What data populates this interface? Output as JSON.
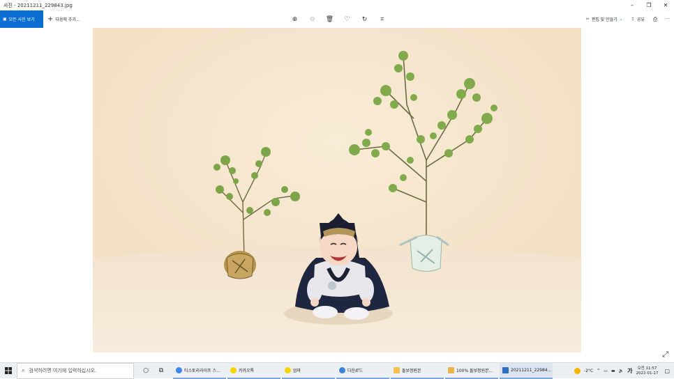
{
  "window": {
    "title": "사진 - 20211211_229843.jpg",
    "controls": {
      "minimize": "–",
      "maximize": "❐",
      "close": "✕"
    }
  },
  "toolbar": {
    "all_photos": "모든 사진 보기",
    "add_to": "다음에 추가...",
    "edit_create": "편집 및 만들기",
    "share": "공유",
    "more": "···"
  },
  "taskbar": {
    "search_placeholder": "검색하려면 여기에 입력하십시오.",
    "apps": [
      {
        "label": "티스토리라이프 스...",
        "color": "#4285f4"
      },
      {
        "label": "카카오톡",
        "color": "#f7d600"
      },
      {
        "label": "엄마",
        "color": "#f7d600"
      },
      {
        "label": "다운로드",
        "color": "#3b82d6"
      },
      {
        "label": "돌보정원본",
        "color": "#f2c14e"
      },
      {
        "label": "100% 돌보정원본...",
        "color": "#e8b54a"
      },
      {
        "label": "20211211_22984...",
        "color": "#2a6fc0"
      }
    ],
    "weather": "-2°C",
    "ime": "가",
    "time": "오전 11:57",
    "date": "2022-01-17"
  },
  "colors": {
    "accent": "#0a6ed1",
    "wall": "#f5e6cc"
  }
}
